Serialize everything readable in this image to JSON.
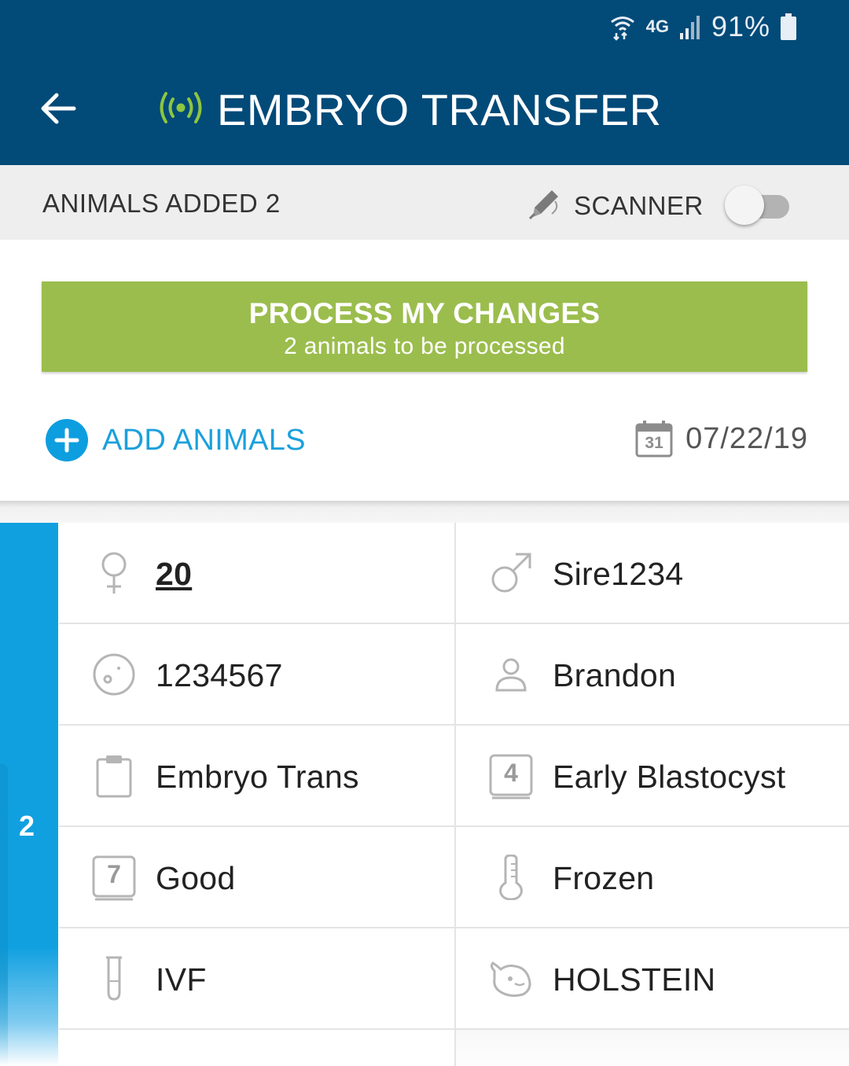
{
  "status_bar": {
    "network": "4G",
    "battery_percent": "91%"
  },
  "app_bar": {
    "title": "EMBRYO TRANSFER"
  },
  "subbar": {
    "animals_added_label": "ANIMALS ADDED 2",
    "scanner_label": "SCANNER",
    "scanner_enabled": false
  },
  "process_button": {
    "title": "PROCESS MY CHANGES",
    "subtitle": "2 animals to be processed"
  },
  "add_animals_label": "ADD ANIMALS",
  "date": {
    "calendar_day": "31",
    "value": "07/22/19"
  },
  "card": {
    "index": "2",
    "cells": {
      "female_id": "20",
      "sire": "Sire1234",
      "embryo_id": "1234567",
      "technician": "Brandon",
      "event": "Embryo Trans",
      "stage_badge": "4",
      "stage": "Early Blastocyst",
      "grade_badge": "7",
      "grade": "Good",
      "storage": "Frozen",
      "method": "IVF",
      "breed": "HOLSTEIN"
    }
  },
  "colors": {
    "header": "#024a78",
    "accent_green": "#9bbd4d",
    "accent_blue": "#10a0e0",
    "radio_icon": "#8dc63f"
  }
}
